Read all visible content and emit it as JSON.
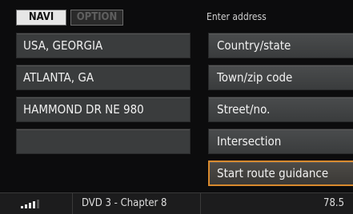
{
  "tabs": {
    "navi": "NAVI",
    "option": "OPTION"
  },
  "heading": "Enter address",
  "fields": [
    "USA, GEORGIA",
    "ATLANTA, GA",
    "HAMMOND DR NE 980",
    ""
  ],
  "buttons": {
    "country_state": "Country/state",
    "town_zip": "Town/zip code",
    "street_no": "Street/no.",
    "intersection": "Intersection",
    "start_route": "Start route guidance"
  },
  "status": {
    "media": "DVD 3 - Chapter 8",
    "frequency": "78.5"
  },
  "colors": {
    "highlight": "#d98a2e",
    "background": "#0c0c0d",
    "button": "#3a3c3d"
  }
}
